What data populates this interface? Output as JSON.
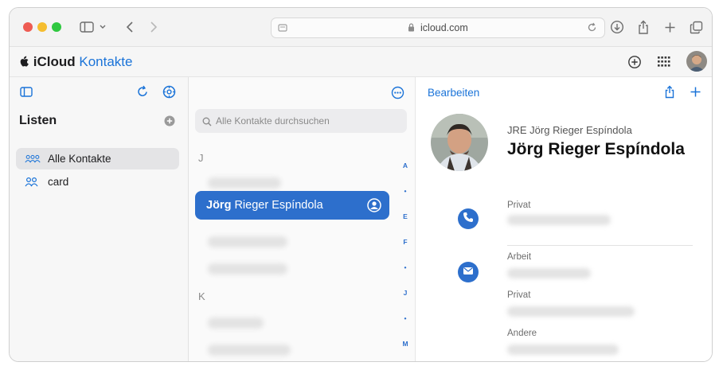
{
  "browser": {
    "url": "icloud.com",
    "traffic_lights": [
      "#ee5b52",
      "#f5bd2f",
      "#2fc840"
    ]
  },
  "app": {
    "brand_prefix": "iCloud",
    "brand_name": "Kontakte"
  },
  "sidebar": {
    "title": "Listen",
    "items": [
      {
        "label": "Alle Kontakte",
        "selected": true
      },
      {
        "label": "card",
        "selected": false
      }
    ]
  },
  "contacts": {
    "search_placeholder": "Alle Kontakte durchsuchen",
    "section_j": "J",
    "section_k": "K",
    "selected": {
      "first": "Jörg",
      "rest": " Rieger Espíndola"
    },
    "index": [
      "A",
      "•",
      "E",
      "F",
      "•",
      "J",
      "•",
      "M",
      "•"
    ]
  },
  "detail": {
    "edit_label": "Bearbeiten",
    "subtitle": "JRE Jörg Rieger Espíndola",
    "name": "Jörg Rieger Espíndola",
    "phone_label": "Privat",
    "email_labels": [
      "Arbeit",
      "Privat",
      "Andere"
    ]
  },
  "colors": {
    "accent": "#1a73d8",
    "selection": "#2d6fcc"
  }
}
